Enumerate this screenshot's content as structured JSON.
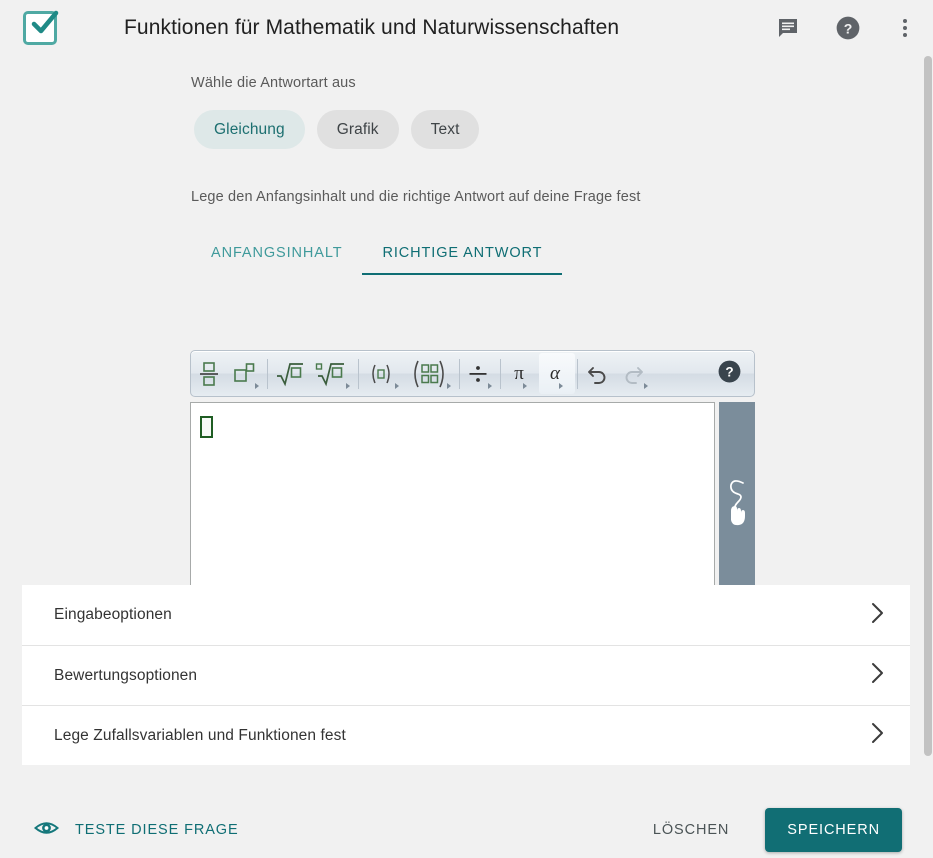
{
  "header": {
    "logo_icon": "check-box-logo",
    "title": "Funktionen für Mathematik und Naturwissenschaften",
    "icons": [
      {
        "name": "feedback-icon",
        "label": "Feedback"
      },
      {
        "name": "help-circle-icon",
        "label": "Hilfe"
      },
      {
        "name": "more-vert-icon",
        "label": "Mehr"
      }
    ]
  },
  "main": {
    "answer_type_label": "Wähle die Antwortart aus",
    "answer_types": [
      {
        "label": "Gleichung",
        "selected": true
      },
      {
        "label": "Grafik",
        "selected": false
      },
      {
        "label": "Text",
        "selected": false
      }
    ],
    "initial_content_label": "Lege den Anfangsinhalt und die richtige Antwort auf deine Frage fest",
    "tabs": [
      {
        "label": "ANFANGSINHALT",
        "active": false
      },
      {
        "label": "RICHTIGE ANTWORT",
        "active": true
      }
    ],
    "editor": {
      "toolbar_buttons": [
        {
          "name": "fraction-icon",
          "has_caret": false
        },
        {
          "name": "exponent-icon",
          "has_caret": true
        },
        {
          "name": "square-root-icon",
          "has_caret": false
        },
        {
          "name": "nth-root-icon",
          "has_caret": true
        },
        {
          "name": "parentheses-icon",
          "has_caret": true
        },
        {
          "name": "matrix-icon",
          "has_caret": true
        },
        {
          "name": "divide-icon",
          "has_caret": true
        },
        {
          "name": "pi-icon",
          "has_caret": true
        },
        {
          "name": "alpha-icon",
          "has_caret": true
        },
        {
          "name": "undo-icon",
          "has_caret": false
        },
        {
          "name": "redo-icon",
          "has_caret": true
        }
      ],
      "toolbar_help_icon": "help-circle-icon",
      "field_value": "",
      "cursor_placeholder": "empty-box-cursor",
      "handwriting_icon": "handwriting-input-icon"
    }
  },
  "accordions": [
    {
      "label": "Eingabeoptionen",
      "icon": "chevron-right-icon"
    },
    {
      "label": "Bewertungsoptionen",
      "icon": "chevron-right-icon"
    },
    {
      "label": "Lege Zufallsvariablen und Funktionen fest",
      "icon": "chevron-right-icon"
    }
  ],
  "footer": {
    "test_icon": "eye-icon",
    "test_label": "TESTE DIESE FRAGE",
    "delete_label": "LÖSCHEN",
    "save_label": "SPEICHERN"
  },
  "colors": {
    "accent_teal": "#116e74",
    "tab_teal": "#0f6e74",
    "chip_selected_bg": "#dee8e8",
    "chip_bg": "#e0e0e0",
    "page_bg": "#f1f1f1",
    "math_green": "#2f6b34",
    "sidebar_slate": "#7b8d9b"
  }
}
